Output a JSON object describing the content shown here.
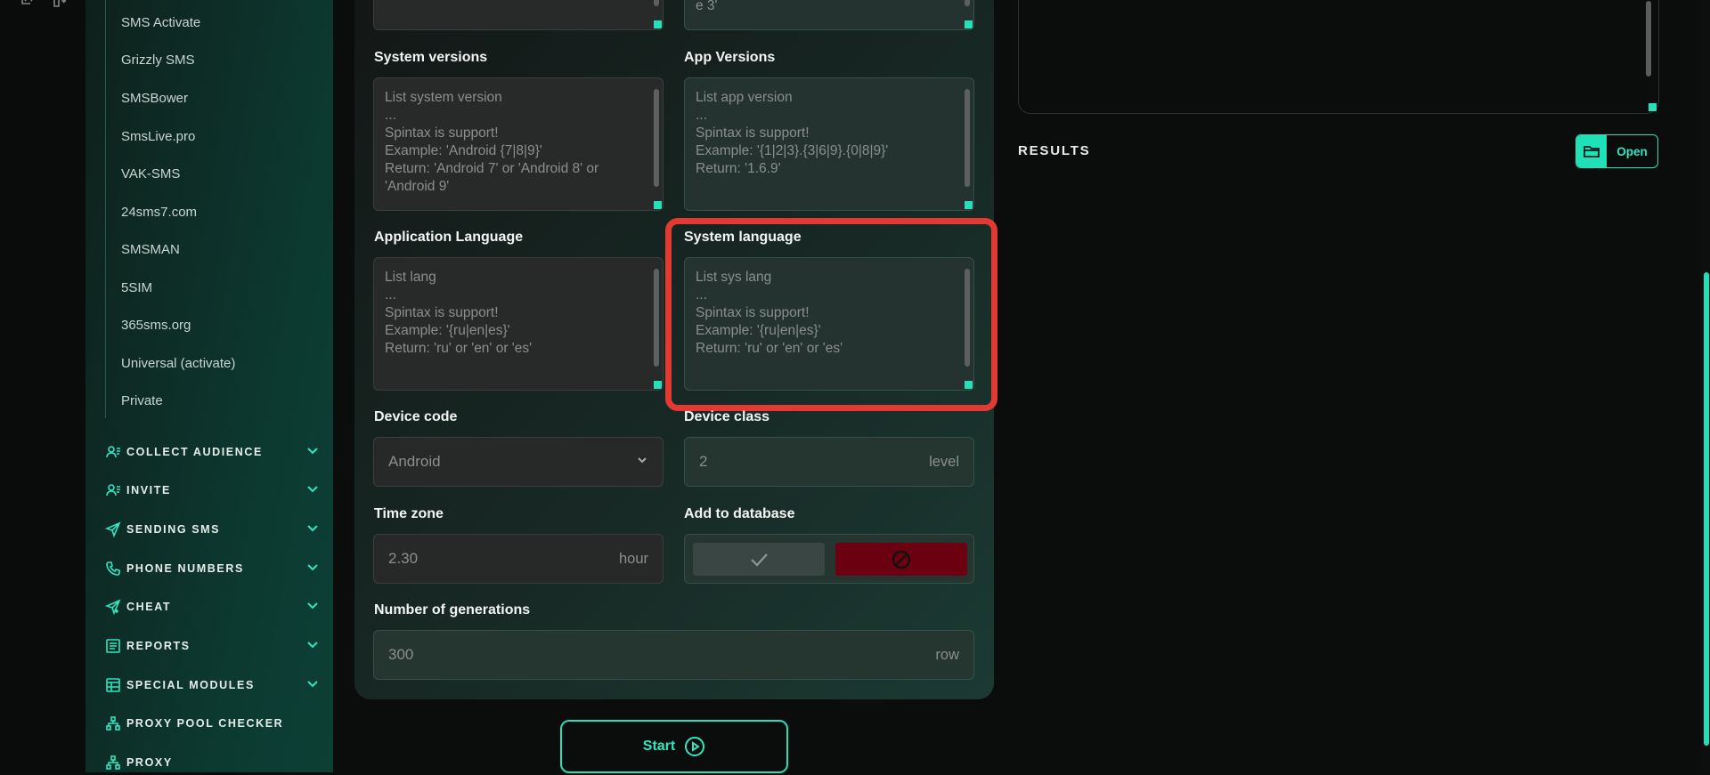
{
  "sidebar": {
    "sub_items": [
      "SMS Activate",
      "Grizzly SMS",
      "SMSBower",
      "SmsLive.pro",
      "VAK-SMS",
      "24sms7.com",
      "SMSMAN",
      "5SIM",
      "365sms.org",
      "Universal (activate)",
      "Private"
    ],
    "nav": [
      {
        "label": "COLLECT AUDIENCE",
        "icon": "users-icon"
      },
      {
        "label": "INVITE",
        "icon": "users-icon"
      },
      {
        "label": "SENDING SMS",
        "icon": "send-icon"
      },
      {
        "label": "PHONE NUMBERS",
        "icon": "phone-icon"
      },
      {
        "label": "CHEAT",
        "icon": "send-plus-icon"
      },
      {
        "label": "REPORTS",
        "icon": "report-icon"
      },
      {
        "label": "SPECIAL MODULES",
        "icon": "table-icon"
      },
      {
        "label": "PROXY POOL CHECKER",
        "icon": "network-icon"
      },
      {
        "label": "PROXY",
        "icon": "network-icon"
      }
    ]
  },
  "form": {
    "top_left_text": "",
    "top_right_text": "e 3'",
    "system_versions": {
      "label": "System versions",
      "placeholder": "List system version\n...\nSpintax is support!\nExample: 'Android {7|8|9}'\nReturn: 'Android 7' or 'Android 8' or 'Android 9'"
    },
    "app_versions": {
      "label": "App Versions",
      "placeholder": "List app version\n...\nSpintax is support!\nExample: '{1|2|3}.{3|6|9}.{0|8|9}'\nReturn: '1.6.9'"
    },
    "app_language": {
      "label": "Application Language",
      "placeholder": "List lang\n...\nSpintax is support!\nExample: '{ru|en|es}'\nReturn: 'ru' or 'en' or 'es'"
    },
    "system_language": {
      "label": "System language",
      "placeholder": "List sys lang\n...\nSpintax is support!\nExample: '{ru|en|es}'\nReturn: 'ru' or 'en' or 'es'"
    },
    "device_code": {
      "label": "Device code",
      "value": "Android"
    },
    "device_class": {
      "label": "Device class",
      "value": "2",
      "suffix": "level"
    },
    "time_zone": {
      "label": "Time zone",
      "value": "2.30",
      "suffix": "hour"
    },
    "add_to_db": {
      "label": "Add to database"
    },
    "generations": {
      "label": "Number of generations",
      "value": "300",
      "suffix": "row"
    },
    "start_label": "Start"
  },
  "results": {
    "title": "RESULTS",
    "open_label": "Open"
  },
  "colors": {
    "accent": "#25e0b8",
    "highlight": "#e23a33",
    "deny": "#6b0010"
  }
}
